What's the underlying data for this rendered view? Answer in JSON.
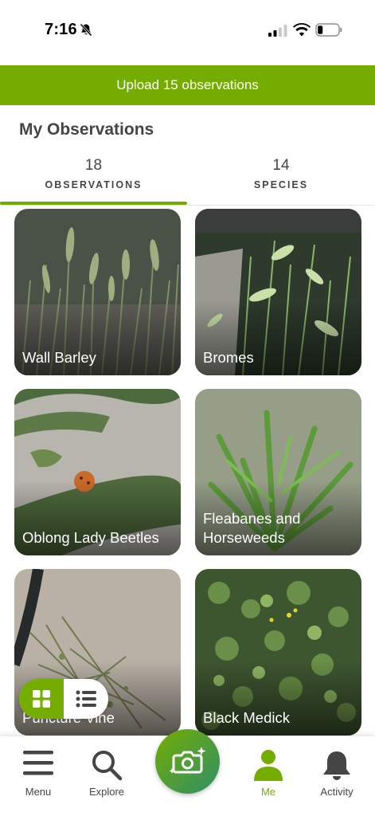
{
  "status_bar": {
    "time": "7:16",
    "icons": [
      "bell-slash-icon",
      "cellular-signal-icon",
      "wifi-icon",
      "battery-low-icon"
    ]
  },
  "upload_banner": {
    "label": "Upload 15 observations",
    "color": "#74ac00"
  },
  "page_title": "My Observations",
  "tabs": [
    {
      "count": "18",
      "label": "OBSERVATIONS",
      "active": true
    },
    {
      "count": "14",
      "label": "SPECIES",
      "active": false
    }
  ],
  "observations": [
    {
      "name": "Wall Barley",
      "photo": "grass-seedheads"
    },
    {
      "name": "Bromes",
      "photo": "grass-seedheads"
    },
    {
      "name": "Oblong Lady Beetles",
      "photo": "beetle-on-leaf"
    },
    {
      "name": "Fleabanes and Horseweeds",
      "photo": "green-weed"
    },
    {
      "name": "Puncture Vine",
      "photo": "sidewalk-weed"
    },
    {
      "name": "Black Medick",
      "photo": "clover-patch"
    }
  ],
  "view_toggle": {
    "grid_icon": "grid-icon",
    "list_icon": "list-icon",
    "selected": "grid"
  },
  "bottom_nav": {
    "items": [
      {
        "label": "Menu",
        "icon": "hamburger-menu-icon"
      },
      {
        "label": "Explore",
        "icon": "search-icon"
      },
      {
        "label": "Me",
        "icon": "person-icon",
        "active": true
      },
      {
        "label": "Activity",
        "icon": "bell-icon"
      }
    ],
    "camera_icon": "camera-sparkle-icon"
  },
  "colors": {
    "accent": "#74ac00",
    "text": "#454545",
    "camera_gradient_end": "#2f8f6a"
  }
}
